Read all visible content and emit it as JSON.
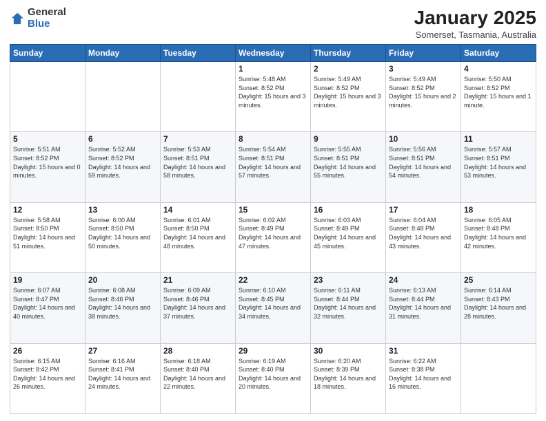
{
  "header": {
    "logo_general": "General",
    "logo_blue": "Blue",
    "title": "January 2025",
    "location": "Somerset, Tasmania, Australia"
  },
  "days_of_week": [
    "Sunday",
    "Monday",
    "Tuesday",
    "Wednesday",
    "Thursday",
    "Friday",
    "Saturday"
  ],
  "weeks": [
    [
      {
        "day": "",
        "info": ""
      },
      {
        "day": "",
        "info": ""
      },
      {
        "day": "",
        "info": ""
      },
      {
        "day": "1",
        "info": "Sunrise: 5:48 AM\nSunset: 8:52 PM\nDaylight: 15 hours\nand 3 minutes."
      },
      {
        "day": "2",
        "info": "Sunrise: 5:49 AM\nSunset: 8:52 PM\nDaylight: 15 hours\nand 3 minutes."
      },
      {
        "day": "3",
        "info": "Sunrise: 5:49 AM\nSunset: 8:52 PM\nDaylight: 15 hours\nand 2 minutes."
      },
      {
        "day": "4",
        "info": "Sunrise: 5:50 AM\nSunset: 8:52 PM\nDaylight: 15 hours\nand 1 minute."
      }
    ],
    [
      {
        "day": "5",
        "info": "Sunrise: 5:51 AM\nSunset: 8:52 PM\nDaylight: 15 hours\nand 0 minutes."
      },
      {
        "day": "6",
        "info": "Sunrise: 5:52 AM\nSunset: 8:52 PM\nDaylight: 14 hours\nand 59 minutes."
      },
      {
        "day": "7",
        "info": "Sunrise: 5:53 AM\nSunset: 8:51 PM\nDaylight: 14 hours\nand 58 minutes."
      },
      {
        "day": "8",
        "info": "Sunrise: 5:54 AM\nSunset: 8:51 PM\nDaylight: 14 hours\nand 57 minutes."
      },
      {
        "day": "9",
        "info": "Sunrise: 5:55 AM\nSunset: 8:51 PM\nDaylight: 14 hours\nand 55 minutes."
      },
      {
        "day": "10",
        "info": "Sunrise: 5:56 AM\nSunset: 8:51 PM\nDaylight: 14 hours\nand 54 minutes."
      },
      {
        "day": "11",
        "info": "Sunrise: 5:57 AM\nSunset: 8:51 PM\nDaylight: 14 hours\nand 53 minutes."
      }
    ],
    [
      {
        "day": "12",
        "info": "Sunrise: 5:58 AM\nSunset: 8:50 PM\nDaylight: 14 hours\nand 51 minutes."
      },
      {
        "day": "13",
        "info": "Sunrise: 6:00 AM\nSunset: 8:50 PM\nDaylight: 14 hours\nand 50 minutes."
      },
      {
        "day": "14",
        "info": "Sunrise: 6:01 AM\nSunset: 8:50 PM\nDaylight: 14 hours\nand 48 minutes."
      },
      {
        "day": "15",
        "info": "Sunrise: 6:02 AM\nSunset: 8:49 PM\nDaylight: 14 hours\nand 47 minutes."
      },
      {
        "day": "16",
        "info": "Sunrise: 6:03 AM\nSunset: 8:49 PM\nDaylight: 14 hours\nand 45 minutes."
      },
      {
        "day": "17",
        "info": "Sunrise: 6:04 AM\nSunset: 8:48 PM\nDaylight: 14 hours\nand 43 minutes."
      },
      {
        "day": "18",
        "info": "Sunrise: 6:05 AM\nSunset: 8:48 PM\nDaylight: 14 hours\nand 42 minutes."
      }
    ],
    [
      {
        "day": "19",
        "info": "Sunrise: 6:07 AM\nSunset: 8:47 PM\nDaylight: 14 hours\nand 40 minutes."
      },
      {
        "day": "20",
        "info": "Sunrise: 6:08 AM\nSunset: 8:46 PM\nDaylight: 14 hours\nand 38 minutes."
      },
      {
        "day": "21",
        "info": "Sunrise: 6:09 AM\nSunset: 8:46 PM\nDaylight: 14 hours\nand 37 minutes."
      },
      {
        "day": "22",
        "info": "Sunrise: 6:10 AM\nSunset: 8:45 PM\nDaylight: 14 hours\nand 34 minutes."
      },
      {
        "day": "23",
        "info": "Sunrise: 6:11 AM\nSunset: 8:44 PM\nDaylight: 14 hours\nand 32 minutes."
      },
      {
        "day": "24",
        "info": "Sunrise: 6:13 AM\nSunset: 8:44 PM\nDaylight: 14 hours\nand 31 minutes."
      },
      {
        "day": "25",
        "info": "Sunrise: 6:14 AM\nSunset: 8:43 PM\nDaylight: 14 hours\nand 28 minutes."
      }
    ],
    [
      {
        "day": "26",
        "info": "Sunrise: 6:15 AM\nSunset: 8:42 PM\nDaylight: 14 hours\nand 26 minutes."
      },
      {
        "day": "27",
        "info": "Sunrise: 6:16 AM\nSunset: 8:41 PM\nDaylight: 14 hours\nand 24 minutes."
      },
      {
        "day": "28",
        "info": "Sunrise: 6:18 AM\nSunset: 8:40 PM\nDaylight: 14 hours\nand 22 minutes."
      },
      {
        "day": "29",
        "info": "Sunrise: 6:19 AM\nSunset: 8:40 PM\nDaylight: 14 hours\nand 20 minutes."
      },
      {
        "day": "30",
        "info": "Sunrise: 6:20 AM\nSunset: 8:39 PM\nDaylight: 14 hours\nand 18 minutes."
      },
      {
        "day": "31",
        "info": "Sunrise: 6:22 AM\nSunset: 8:38 PM\nDaylight: 14 hours\nand 16 minutes."
      },
      {
        "day": "",
        "info": ""
      }
    ]
  ]
}
